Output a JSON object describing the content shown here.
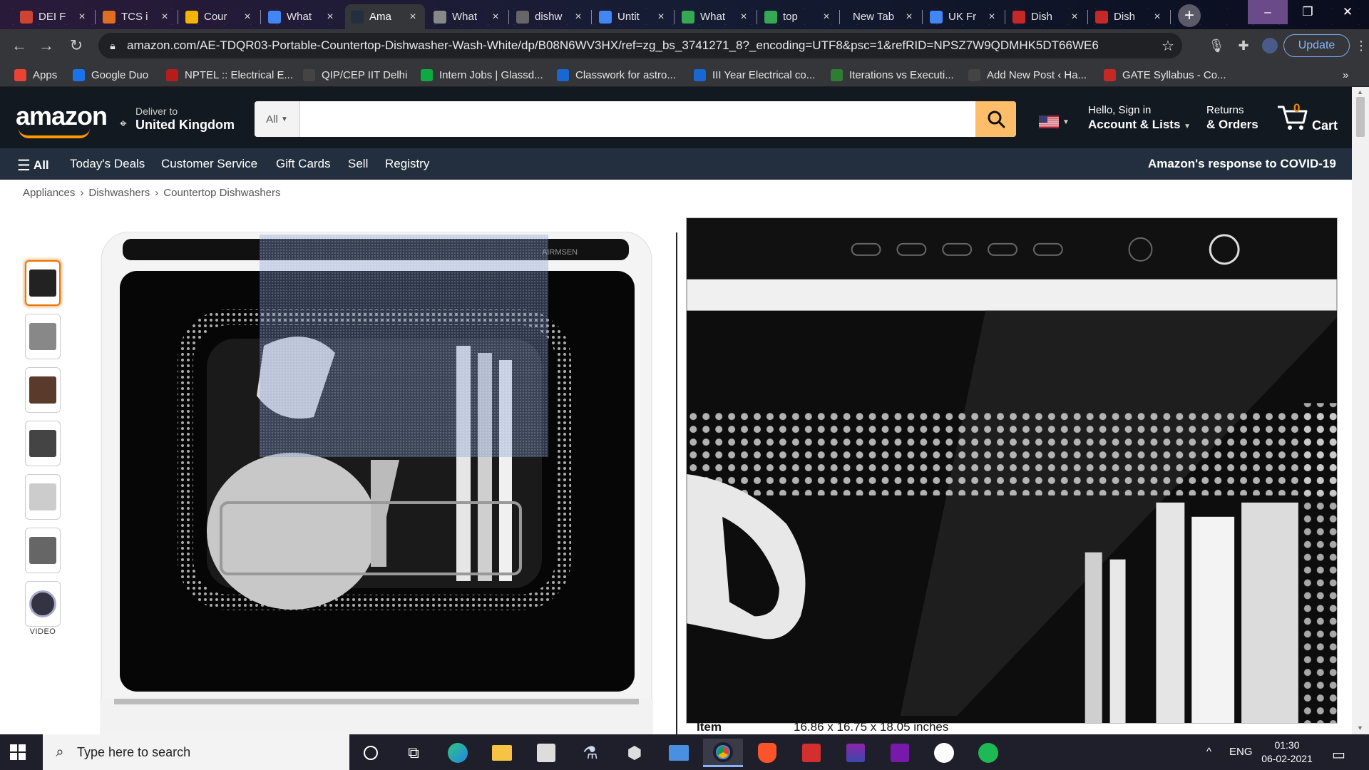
{
  "browser": {
    "tabs": [
      {
        "title": "DEI F",
        "fav": "#c43"
      },
      {
        "title": "TCS i",
        "fav": "#e06e20"
      },
      {
        "title": "Cour",
        "fav": "#f4b400"
      },
      {
        "title": "What",
        "fav": "#4285f4"
      },
      {
        "title": "Ama",
        "fav": "#232f3e",
        "active": true
      },
      {
        "title": "What",
        "fav": "#888"
      },
      {
        "title": "dishw",
        "fav": "#666"
      },
      {
        "title": "Untit",
        "fav": "#4285f4"
      },
      {
        "title": "What",
        "fav": "#34a853"
      },
      {
        "title": "top",
        "fav": "#34a853"
      },
      {
        "title": "New Tab",
        "fav": ""
      },
      {
        "title": "UK Fr",
        "fav": "#4285f4"
      },
      {
        "title": "Dish",
        "fav": "#c62828"
      },
      {
        "title": "Dish",
        "fav": "#c62828"
      }
    ],
    "url": "amazon.com/AE-TDQR03-Portable-Countertop-Dishwasher-Wash-White/dp/B08N6WV3HX/ref=zg_bs_3741271_8?_encoding=UTF8&psc=1&refRID=NPSZ7W9QDMHK5DT66WE6",
    "update_label": "Update",
    "bookmarks": [
      {
        "label": "Apps",
        "color": "#ea4335"
      },
      {
        "label": "Google Duo",
        "color": "#1a73e8"
      },
      {
        "label": "NPTEL :: Electrical E...",
        "color": "#b71c1c"
      },
      {
        "label": "QIP/CEP IIT Delhi",
        "color": "#444"
      },
      {
        "label": "Intern Jobs | Glassd...",
        "color": "#0caa41"
      },
      {
        "label": "Classwork for astro...",
        "color": "#1967d2"
      },
      {
        "label": "III Year Electrical co...",
        "color": "#1967d2"
      },
      {
        "label": "Iterations vs Executi...",
        "color": "#2e7d32"
      },
      {
        "label": "Add New Post ‹ Ha...",
        "color": "#444"
      },
      {
        "label": "GATE Syllabus - Co...",
        "color": "#c62828"
      }
    ],
    "more": "»"
  },
  "amazon": {
    "logo": "amazon",
    "deliver_line1": "Deliver to",
    "deliver_line2": "United Kingdom",
    "search_category": "All",
    "search_placeholder": "",
    "account_line1": "Hello, Sign in",
    "account_line2": "Account & Lists",
    "orders_line1": "Returns",
    "orders_line2": "& Orders",
    "cart_count": "0",
    "cart_label": "Cart",
    "nav": {
      "all": "All",
      "todays_deals": "Today's Deals",
      "customer_service": "Customer Service",
      "gift_cards": "Gift Cards",
      "sell": "Sell",
      "registry": "Registry",
      "covid": "Amazon's response to COVID-19"
    },
    "breadcrumbs": [
      "Appliances",
      "Dishwashers",
      "Countertop Dishwashers"
    ],
    "breadcrumb_sep": "›",
    "video_label": "VIDEO",
    "brand_text": "AIRMSEN",
    "item_label": "Item",
    "item_value": "16.86 x 16.75 x 18.05 inches"
  },
  "taskbar": {
    "search_placeholder": "Type here to search",
    "lang": "ENG",
    "time": "01:30",
    "date": "06-02-2021"
  }
}
